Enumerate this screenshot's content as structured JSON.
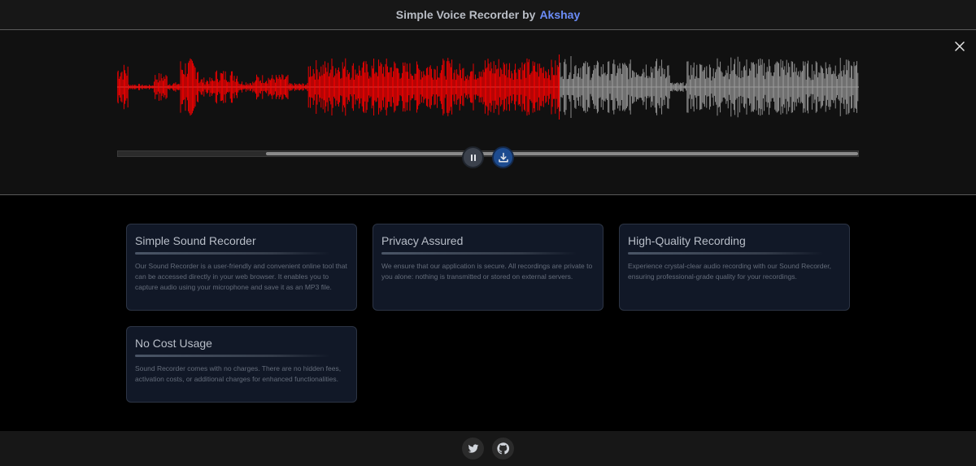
{
  "header": {
    "title_prefix": "Simple Voice Recorder by",
    "author": "Akshay"
  },
  "colors": {
    "played_wave": "#ff0000",
    "unplayed_wave": "#9a9a9a",
    "author_link": "#6b8cf7",
    "download_button": "#1d4b8f"
  },
  "recorder": {
    "playback_progress": 0.596,
    "scroll_position": 0.2,
    "icons": {
      "close": "close-icon",
      "pause": "pause-icon",
      "download": "download-icon"
    }
  },
  "features": [
    {
      "title": "Simple Sound Recorder",
      "body": "Our Sound Recorder is a user-friendly and convenient online tool that can be accessed directly in your web browser. It enables you to capture audio using your microphone and save it as an MP3 file."
    },
    {
      "title": "Privacy Assured",
      "body": "We ensure that our application is secure. All recordings are private to you alone: nothing is transmitted or stored on external servers."
    },
    {
      "title": "High-Quality Recording",
      "body": "Experience crystal-clear audio recording with our Sound Recorder, ensuring professional-grade quality for your recordings."
    },
    {
      "title": "No Cost Usage",
      "body": "Sound Recorder comes with no charges. There are no hidden fees, activation costs, or additional charges for enhanced functionalities."
    }
  ],
  "footer": {
    "icons": [
      "twitter-icon",
      "github-icon"
    ]
  }
}
